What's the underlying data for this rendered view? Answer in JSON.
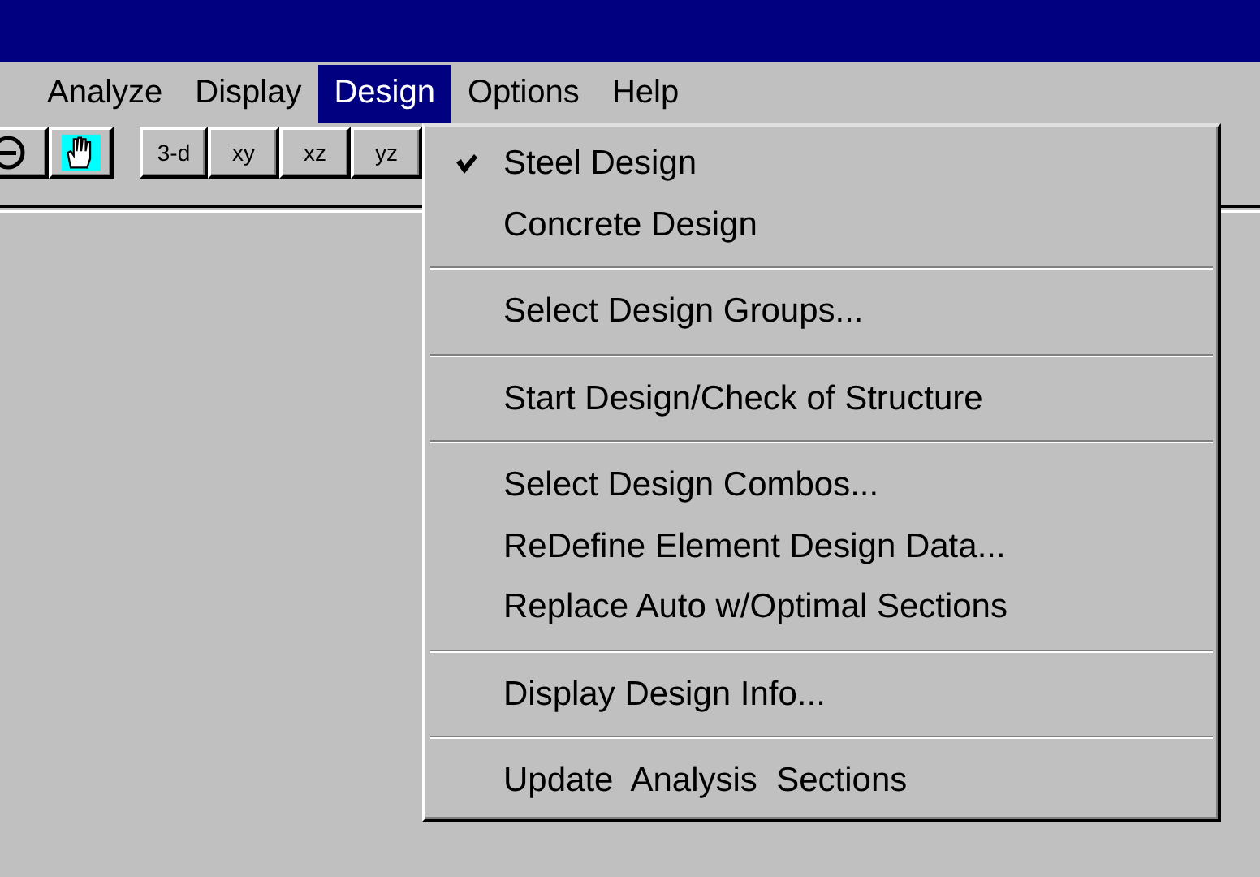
{
  "menu_bar": [
    {
      "label": "Analyze",
      "selected": false
    },
    {
      "label": "Display",
      "selected": false
    },
    {
      "label": "Design",
      "selected": true
    },
    {
      "label": "Options",
      "selected": false
    },
    {
      "label": "Help",
      "selected": false
    }
  ],
  "toolbar": [
    {
      "kind": "zoom"
    },
    {
      "kind": "pan"
    },
    {
      "kind": "text",
      "label": "3-d"
    },
    {
      "kind": "text",
      "label": "xy"
    },
    {
      "kind": "text",
      "label": "xz"
    },
    {
      "kind": "text",
      "label": "yz"
    }
  ],
  "design_menu": [
    {
      "kind": "item",
      "label": "Steel Design",
      "checked": true
    },
    {
      "kind": "item",
      "label": "Concrete Design",
      "checked": false
    },
    {
      "kind": "separator"
    },
    {
      "kind": "item",
      "label": "Select Design Groups...",
      "checked": false
    },
    {
      "kind": "separator"
    },
    {
      "kind": "item",
      "label": "Start Design/Check of Structure",
      "checked": false
    },
    {
      "kind": "separator"
    },
    {
      "kind": "item",
      "label": "Select Design Combos...",
      "checked": false
    },
    {
      "kind": "item",
      "label": "ReDefine Element Design Data...",
      "checked": false
    },
    {
      "kind": "item",
      "label": "Replace Auto w/Optimal Sections",
      "checked": false
    },
    {
      "kind": "separator"
    },
    {
      "kind": "item",
      "label": "Display Design Info...",
      "checked": false
    },
    {
      "kind": "separator"
    },
    {
      "kind": "item",
      "label": "Update  Analysis  Sections",
      "checked": false
    }
  ]
}
